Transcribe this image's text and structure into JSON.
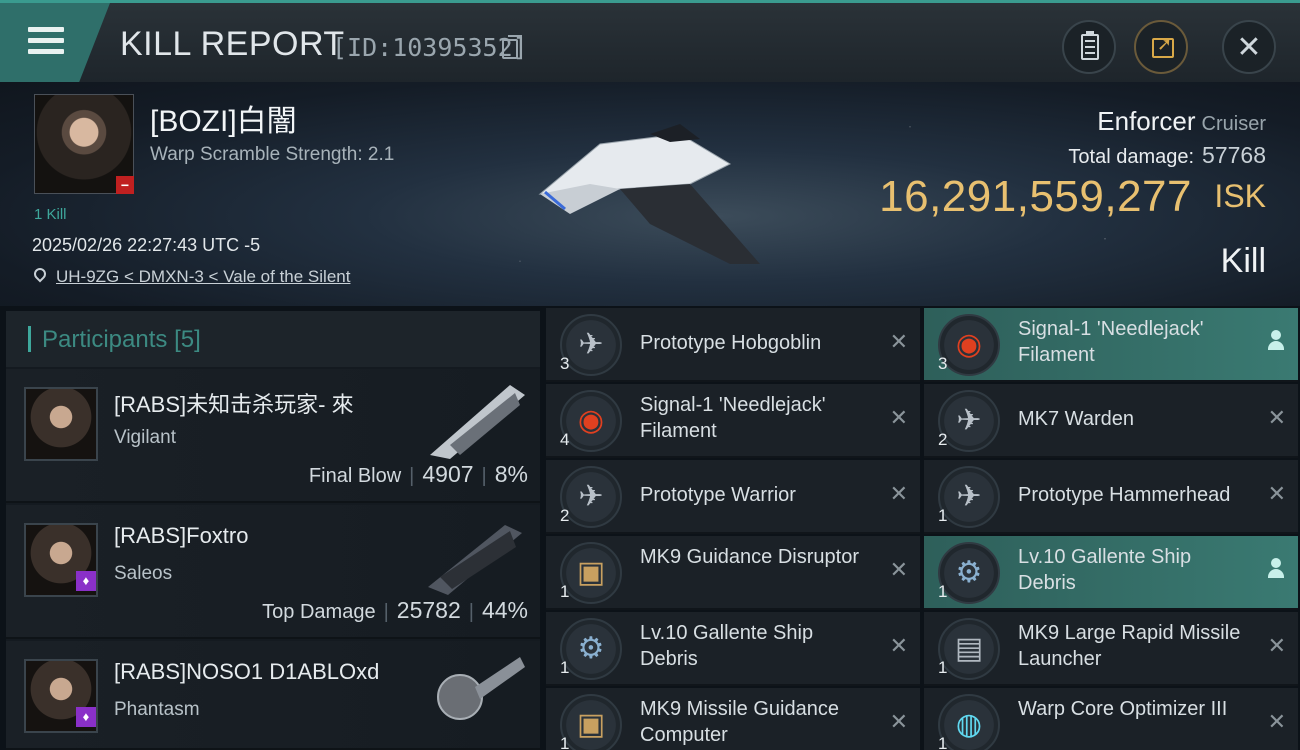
{
  "header": {
    "title": "KILL REPORT",
    "report_id": "[ID:10395352]"
  },
  "victim": {
    "name": "[BOZI]白闇",
    "warp_scramble": "Warp Scramble Strength: 2.1",
    "kill_count": "1 Kill",
    "timestamp": "2025/02/26 22:27:43 UTC -5",
    "location": "UH-9ZG < DMXN-3 < Vale of the Silent",
    "ship_name": "Enforcer",
    "ship_class": "Cruiser",
    "total_damage_label": "Total damage:",
    "total_damage": "57768",
    "isk_value": "16,291,559,277",
    "isk_unit": "ISK",
    "result": "Kill"
  },
  "participants": {
    "label": "Participants",
    "count": "[5]",
    "rows": [
      {
        "name": "[RABS]未知击杀玩家- 來",
        "ship": "Vigilant",
        "tag": "Final Blow",
        "damage": "4907",
        "percent": "8%",
        "badge": ""
      },
      {
        "name": "[RABS]Foxtro",
        "ship": "Saleos",
        "tag": "Top Damage",
        "damage": "25782",
        "percent": "44%",
        "badge": "♦"
      },
      {
        "name": "[RABS]NOSO1 D1ABLOxd",
        "ship": "Phantasm",
        "tag": "",
        "damage": "",
        "percent": "",
        "badge": "♦"
      }
    ]
  },
  "items": [
    {
      "name": "Prototype  Hobgoblin",
      "qty": "3",
      "icon": "drone-icon",
      "highlight": false,
      "dropped": false
    },
    {
      "name": " Signal-1 'Needlejack' Filament",
      "qty": "3",
      "icon": "filament-icon",
      "highlight": true,
      "dropped": true
    },
    {
      "name": " Signal-1 'Needlejack' Filament",
      "qty": "4",
      "icon": "filament-icon",
      "highlight": false,
      "dropped": false
    },
    {
      "name": "MK7  Warden",
      "qty": "2",
      "icon": "drone-icon",
      "highlight": false,
      "dropped": false
    },
    {
      "name": "Prototype  Warrior",
      "qty": "2",
      "icon": "drone-icon",
      "highlight": false,
      "dropped": false
    },
    {
      "name": "Prototype  Hammerhead",
      "qty": "1",
      "icon": "drone-icon",
      "highlight": false,
      "dropped": false
    },
    {
      "name": "MK9 Guidance Disruptor",
      "qty": "1",
      "icon": "module-icon",
      "highlight": false,
      "dropped": false
    },
    {
      "name": "Lv.10 Gallente Ship Debris",
      "qty": "1",
      "icon": "debris-icon",
      "highlight": true,
      "dropped": true
    },
    {
      "name": "Lv.10 Gallente Ship Debris",
      "qty": "1",
      "icon": "debris-icon",
      "highlight": false,
      "dropped": false
    },
    {
      "name": "MK9 Large Rapid Missile Launcher",
      "qty": "1",
      "icon": "launcher-icon",
      "highlight": false,
      "dropped": false
    },
    {
      "name": "MK9 Missile Guidance Computer",
      "qty": "1",
      "icon": "module-icon",
      "highlight": false,
      "dropped": false
    },
    {
      "name": "Warp Core Optimizer III",
      "qty": "1",
      "icon": "rig-icon",
      "highlight": false,
      "dropped": false
    }
  ],
  "colors": {
    "accent": "#3ea89c",
    "isk": "#e8c070",
    "highlight_row": "#3a7a72"
  }
}
